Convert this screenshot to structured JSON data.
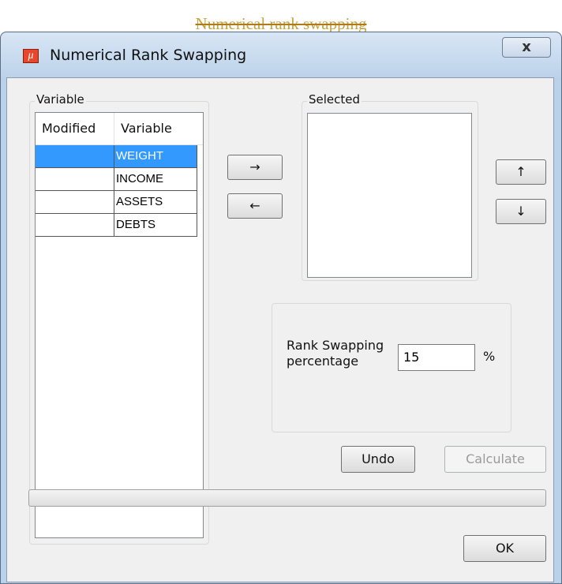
{
  "caption": "Numerical rank swapping",
  "window": {
    "title": "Numerical Rank Swapping",
    "close_label": "x"
  },
  "variable_group": {
    "label": "Variable",
    "columns": [
      "Modified",
      "Variable"
    ],
    "rows": [
      {
        "modified": "",
        "variable": "WEIGHT",
        "selected": true
      },
      {
        "modified": "",
        "variable": "INCOME",
        "selected": false
      },
      {
        "modified": "",
        "variable": "ASSETS",
        "selected": false
      },
      {
        "modified": "",
        "variable": "DEBTS",
        "selected": false
      }
    ]
  },
  "move_buttons": {
    "add": "→",
    "remove": "←"
  },
  "selected_group": {
    "label": "Selected"
  },
  "order_buttons": {
    "up": "↑",
    "down": "↓"
  },
  "percentage": {
    "label_line1": "Rank Swapping",
    "label_line2": "percentage",
    "value": "15",
    "unit": "%"
  },
  "actions": {
    "undo": "Undo",
    "calculate": "Calculate",
    "ok": "OK"
  },
  "progress": {
    "value": 0
  },
  "colors": {
    "selection": "#3399ff",
    "caption": "#c8a23a"
  }
}
